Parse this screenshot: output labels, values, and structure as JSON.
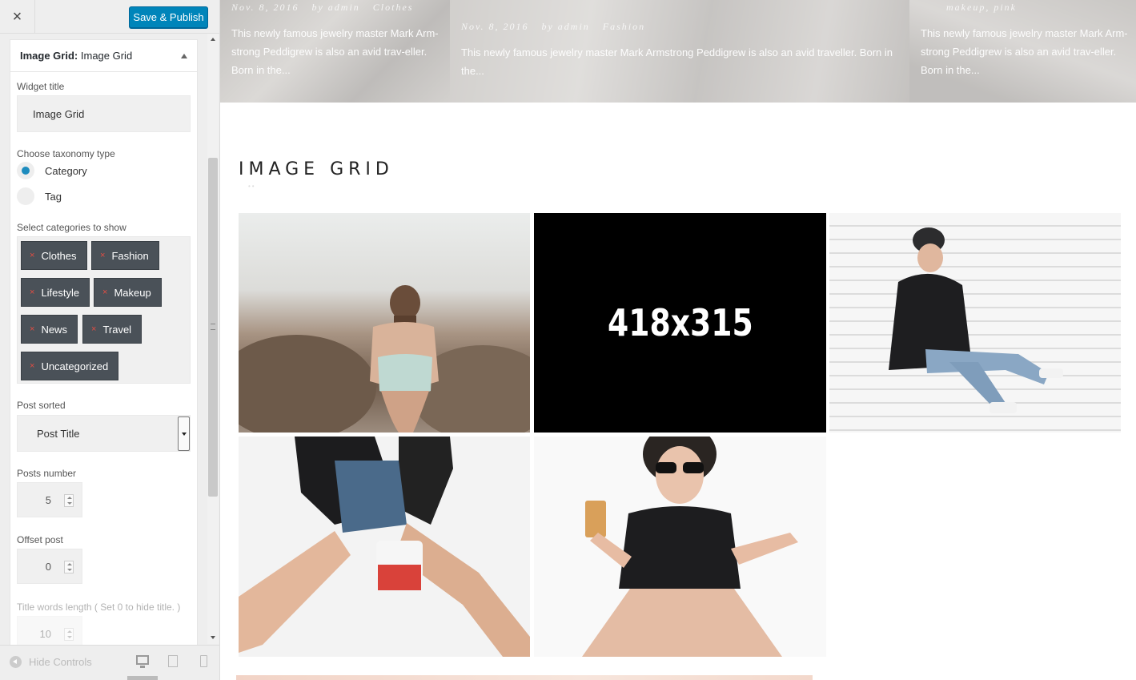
{
  "topbar": {
    "close_icon": "×",
    "publish_label": "Save & Publish"
  },
  "panel": {
    "title_prefix": "Image Grid:",
    "title_name": "Image Grid",
    "widget_title_label": "Widget title",
    "widget_title_value": "Image Grid",
    "taxonomy_label": "Choose taxonomy type",
    "taxonomy_options": [
      "Category",
      "Tag"
    ],
    "taxonomy_selected": "Category",
    "categories_label": "Select categories to show",
    "categories": [
      "Clothes",
      "Fashion",
      "Lifestyle",
      "Makeup",
      "News",
      "Travel",
      "Uncategorized"
    ],
    "chip_remove_icon": "×",
    "sorted_label": "Post sorted",
    "sorted_value": "Post Title",
    "posts_number_label": "Posts number",
    "posts_number_value": "5",
    "offset_label": "Offset post",
    "offset_value": "0",
    "title_words_label": "Title words length ( Set 0 to hide title. )",
    "title_words_value": "10"
  },
  "footer": {
    "hide_controls_label": "Hide Controls"
  },
  "preview": {
    "posts": [
      {
        "date": "Nov. 8, 2016",
        "author": "by admin",
        "category": "Clothes",
        "excerpt": "This newly famous jewelry master Mark Arm-strong Peddigrew is also an avid trav-eller. Born in the..."
      },
      {
        "date": "Nov. 8, 2016",
        "author": "by admin",
        "category": "Fashion",
        "excerpt": "This newly famous jewelry master Mark Armstrong Peddigrew is also an avid traveller. Born in the..."
      },
      {
        "date": "",
        "author": "",
        "category": "makeup, pink",
        "excerpt": "This newly famous jewelry master Mark Arm-strong Peddigrew is also an avid trav-eller. Born in the..."
      }
    ],
    "grid_title": "IMAGE GRID",
    "placeholder_text": "418x315"
  },
  "colors": {
    "accent": "#0085ba",
    "chip_bg": "#4a5158",
    "chip_remove": "#e14d43"
  }
}
